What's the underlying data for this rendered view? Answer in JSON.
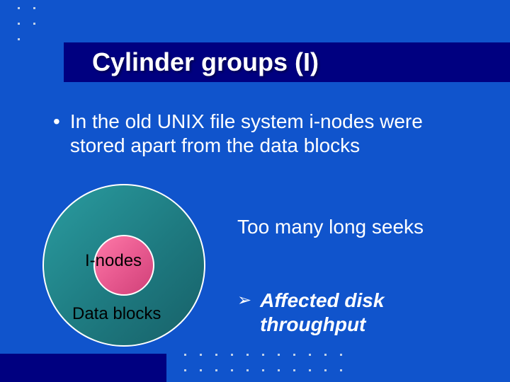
{
  "title": "Cylinder groups (I)",
  "bullet_main": "In the old UNIX file system i-nodes were stored  apart from the data blocks",
  "diagram": {
    "inner_label": "I-nodes",
    "outer_label": "Data blocks"
  },
  "seek_line": "Too many long seeks",
  "arrow_line1": "Affected disk",
  "arrow_line2": "throughput",
  "colors": {
    "bg": "#1054cc",
    "title_bar": "#000080",
    "outer_disk": "#1e7a80",
    "inner_disk": "#e85a90"
  }
}
